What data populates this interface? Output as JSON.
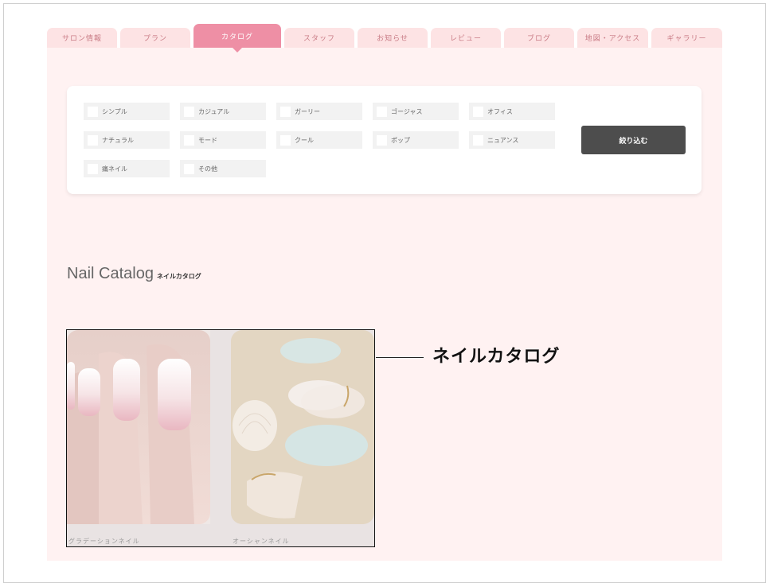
{
  "tabs": [
    {
      "label": "サロン情報"
    },
    {
      "label": "プラン"
    },
    {
      "label": "カタログ"
    },
    {
      "label": "スタッフ"
    },
    {
      "label": "お知らせ"
    },
    {
      "label": "レビュー"
    },
    {
      "label": "ブログ"
    },
    {
      "label": "地図・アクセス"
    },
    {
      "label": "ギャラリー"
    }
  ],
  "active_tab": "カタログ",
  "filters": [
    {
      "label": "シンプル"
    },
    {
      "label": "カジュアル"
    },
    {
      "label": "ガーリー"
    },
    {
      "label": "ゴージャス"
    },
    {
      "label": "オフィス"
    },
    {
      "label": "ナチュラル"
    },
    {
      "label": "モード"
    },
    {
      "label": "クール"
    },
    {
      "label": "ポップ"
    },
    {
      "label": "ニュアンス"
    },
    {
      "label": "痛ネイル"
    },
    {
      "label": "その他"
    }
  ],
  "filter_button": "絞り込む",
  "section": {
    "title_en": "Nail Catalog",
    "title_jp": "ネイルカタログ"
  },
  "gallery": [
    {
      "caption": "グラデーションネイル"
    },
    {
      "caption": "オーシャンネイル"
    }
  ],
  "annotation": "ネイルカタログ",
  "colors": {
    "panel": "#fff2f2",
    "tab": "#fde3e4",
    "tab_active": "#ee8fa5",
    "button": "#4d4d4d"
  }
}
